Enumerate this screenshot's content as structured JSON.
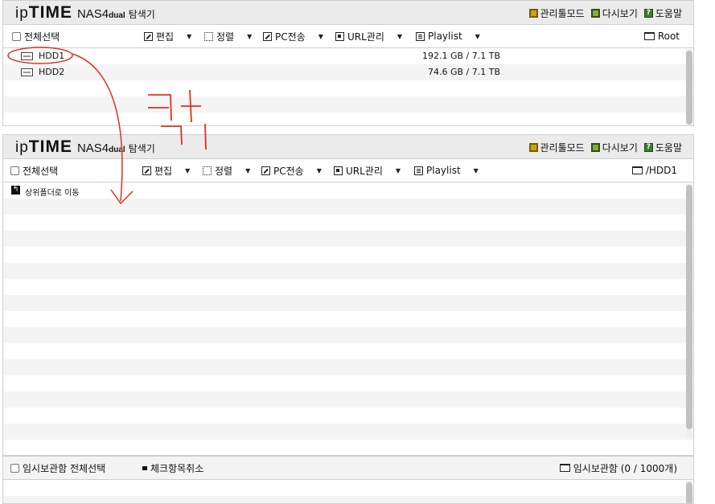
{
  "brand": {
    "ip": "ip",
    "time": "TIME",
    "nas": "NAS4",
    "dual": "dual",
    "explorer": "탐색기"
  },
  "header_links": {
    "admin": "관리툴모드",
    "refresh": "다시보기",
    "help": "도움말",
    "help_glyph": "?"
  },
  "toolbar": {
    "select_all": "전체선택",
    "edit": "편집",
    "sort": "정렬",
    "pc_transfer": "PC전송",
    "url_manage": "URL관리",
    "playlist": "Playlist",
    "caret": "▼"
  },
  "panel1": {
    "path": "Root",
    "rows": [
      {
        "name": "HDD1",
        "size": "192.1 GB / 7.1 TB"
      },
      {
        "name": "HDD2",
        "size": "74.6 GB / 7.1 TB"
      }
    ]
  },
  "panel2": {
    "path": "/HDD1",
    "up_glyph": "↰",
    "up_label": "상위폴더로 이동"
  },
  "panel3": {
    "select_all": "임시보관함 전체선택",
    "uncheck": "체크항목취소",
    "storage": "임시보관함 (0 / 1000개)"
  }
}
